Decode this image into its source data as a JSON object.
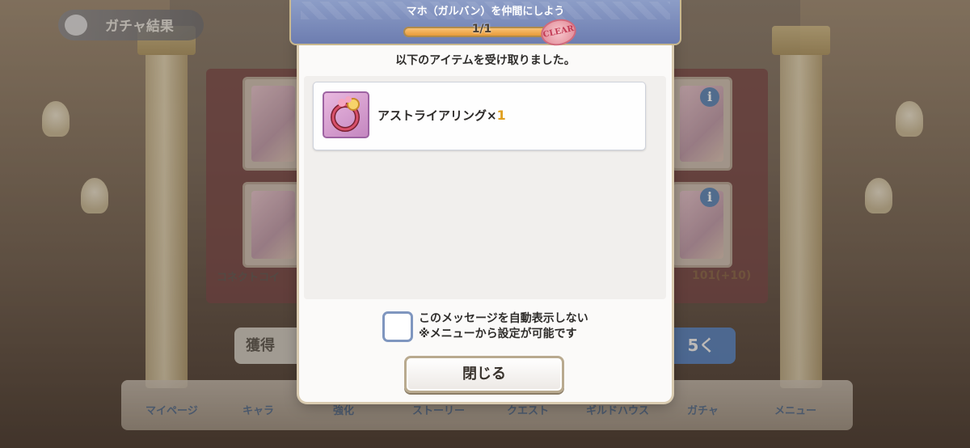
{
  "background": {
    "screen_title": "ガチャ結果",
    "coin_label": "コネクトコイ",
    "count_text": "101(+10)",
    "grey_button_label": "獲得",
    "blue_button_label": "5く",
    "nav": [
      "マイページ",
      "キャラ",
      "強化",
      "ストーリー",
      "クエスト",
      "ギルドハウス",
      "ガチャ",
      "メニュー"
    ]
  },
  "quest": {
    "title": "マホ（ガルバン）を仲間にしよう",
    "progress_text": "1/1",
    "progress_fraction": 1.0,
    "clear_badge": "CLEAR"
  },
  "dialog": {
    "received_message": "以下のアイテムを受け取りました。",
    "items": [
      {
        "name": "アストライアリング×",
        "quantity": "1",
        "icon": "ring-icon"
      }
    ],
    "checkbox_line1": "このメッセージを自動表示しない",
    "checkbox_line2": "※メニューから設定が可能です",
    "checkbox_checked": false,
    "close_label": "閉じる"
  },
  "colors": {
    "header_blue": "#7b8bbd",
    "progress_orange": "#e89b3a",
    "quantity_gold": "#e0a020",
    "checkbox_border": "#7f96bf"
  }
}
